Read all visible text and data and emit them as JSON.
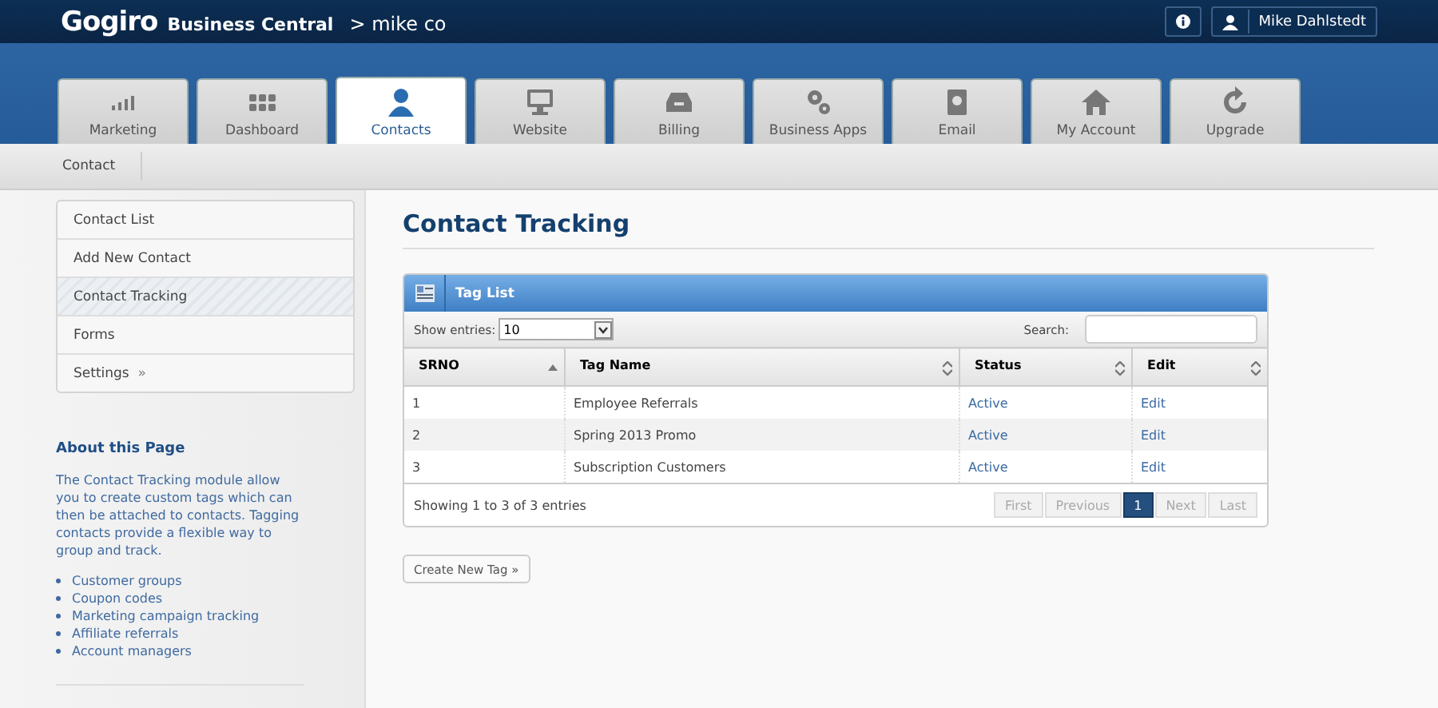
{
  "header": {
    "logo": "Gogiro",
    "product": "Business Central",
    "account": "> mike co",
    "user": "Mike Dahlstedt"
  },
  "tabs": [
    {
      "label": "Marketing",
      "selected": false
    },
    {
      "label": "Dashboard",
      "selected": false
    },
    {
      "label": "Contacts",
      "selected": true
    },
    {
      "label": "Website",
      "selected": false
    },
    {
      "label": "Billing",
      "selected": false
    },
    {
      "label": "Business Apps",
      "selected": false
    },
    {
      "label": "Email",
      "selected": false
    },
    {
      "label": "My Account",
      "selected": false
    },
    {
      "label": "Upgrade",
      "selected": false
    }
  ],
  "breadcrumb": "Contact",
  "sidebar": {
    "items": [
      {
        "label": "Contact List",
        "selected": false
      },
      {
        "label": "Add New Contact",
        "selected": false
      },
      {
        "label": "Contact Tracking",
        "selected": true
      },
      {
        "label": "Forms",
        "selected": false
      },
      {
        "label": "Settings",
        "more": "»",
        "selected": false
      }
    ],
    "about": {
      "title": "About this Page",
      "text": "The Contact Tracking module allow you to create custom tags which can then be attached to contacts. Tagging contacts provide a flexible way to group and track.",
      "bullets": [
        "Customer groups",
        "Coupon codes",
        "Marketing campaign tracking",
        "Affiliate referrals",
        "Account managers"
      ]
    }
  },
  "page_title": "Contact Tracking",
  "panel": {
    "title": "Tag List",
    "show_entries_label": "Show entries:",
    "show_entries_value": "10",
    "search_label": "Search:",
    "columns": [
      "SRNO",
      "Tag Name",
      "Status",
      "Edit"
    ],
    "rows": [
      [
        "1",
        "Employee Referrals",
        "Active",
        "Edit"
      ],
      [
        "2",
        "Spring 2013 Promo",
        "Active",
        "Edit"
      ],
      [
        "3",
        "Subscription Customers",
        "Active",
        "Edit"
      ]
    ],
    "info": "Showing 1 to 3 of 3 entries",
    "pages": [
      {
        "label": "First",
        "selected": false,
        "disabled": true
      },
      {
        "label": "Previous",
        "selected": false,
        "disabled": true
      },
      {
        "label": "1",
        "selected": true,
        "disabled": false
      },
      {
        "label": "Next",
        "selected": false,
        "disabled": true
      },
      {
        "label": "Last",
        "selected": false,
        "disabled": true
      }
    ]
  },
  "create_button": "Create New Tag »"
}
